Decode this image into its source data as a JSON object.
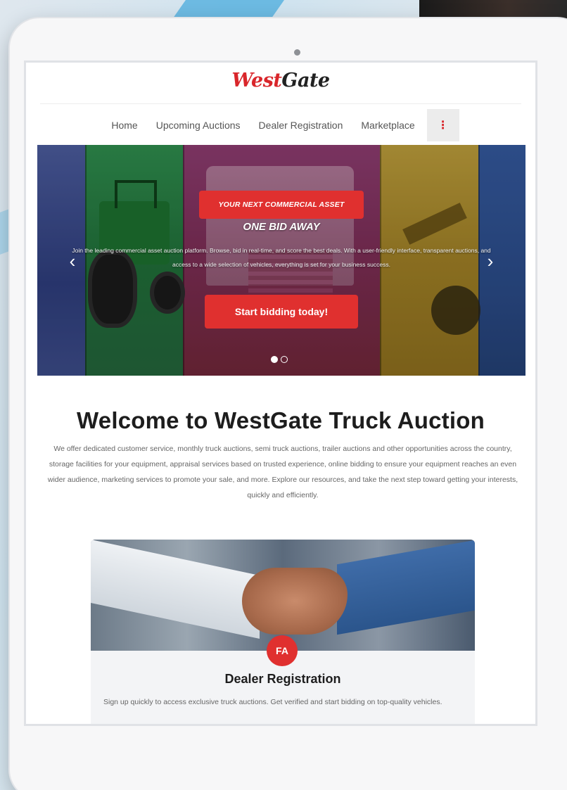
{
  "brand": {
    "logo_west": "West",
    "logo_gate": "Gate"
  },
  "nav": {
    "items": [
      "Home",
      "Upcoming Auctions",
      "Dealer Registration",
      "Marketplace"
    ],
    "more_icon": "⋮"
  },
  "hero": {
    "badge": "YOUR NEXT COMMERCIAL ASSET",
    "subtitle": "ONE BID AWAY",
    "description": "Join the leading commercial asset auction platform. Browse, bid in real-time, and score the best deals. With a user-friendly interface, transparent auctions, and access to a wide selection of vehicles, everything is set for your business success.",
    "cta": "Start bidding today!",
    "prev_icon": "‹",
    "next_icon": "›",
    "slides_total": 2,
    "slide_active": 1
  },
  "welcome": {
    "title": "Welcome to WestGate Truck Auction",
    "body": "We offer dedicated customer service, monthly truck auctions, semi truck auctions, trailer auctions and other opportunities across the country, storage facilities for your equipment, appraisal services based on trusted experience, online bidding to ensure your equipment reaches an even wider audience, marketing services to promote your sale, and more. Explore our resources, and take the next step toward getting your interests, quickly and efficiently."
  },
  "dealer_card": {
    "icon_text": "FA",
    "title": "Dealer Registration",
    "description": "Sign up quickly to access exclusive truck auctions. Get verified and start bidding on top-quality vehicles."
  },
  "colors": {
    "accent": "#e0302f",
    "text": "#1d1d1d",
    "muted": "#666666"
  }
}
